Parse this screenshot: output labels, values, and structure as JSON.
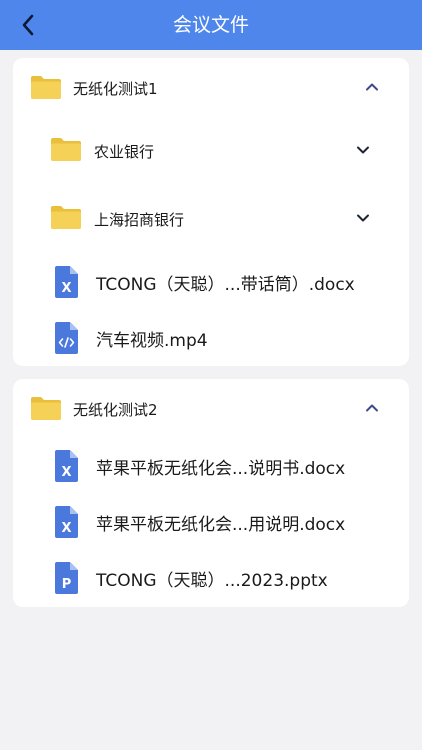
{
  "header": {
    "title": "会议文件",
    "back_icon": "chevron-left-icon"
  },
  "colors": {
    "header": "#4f86ec",
    "folder": "#f5d257",
    "file_icon": "#4a78dc",
    "chevron": "#3d4a8f"
  },
  "groups": [
    {
      "name": "无纸化测试1",
      "expanded": true,
      "subfolders": [
        {
          "name": "农业银行",
          "expanded": false
        },
        {
          "name": "上海招商银行",
          "expanded": false
        }
      ],
      "files": [
        {
          "name": "TCONG（天聪）...带话筒）.docx",
          "type": "word"
        },
        {
          "name": "汽车视频.mp4",
          "type": "code"
        }
      ]
    },
    {
      "name": "无纸化测试2",
      "expanded": true,
      "files": [
        {
          "name": "苹果平板无纸化会...说明书.docx",
          "type": "word"
        },
        {
          "name": "苹果平板无纸化会...用说明.docx",
          "type": "word"
        },
        {
          "name": "TCONG（天聪）...2023.pptx",
          "type": "powerpoint"
        }
      ]
    }
  ]
}
